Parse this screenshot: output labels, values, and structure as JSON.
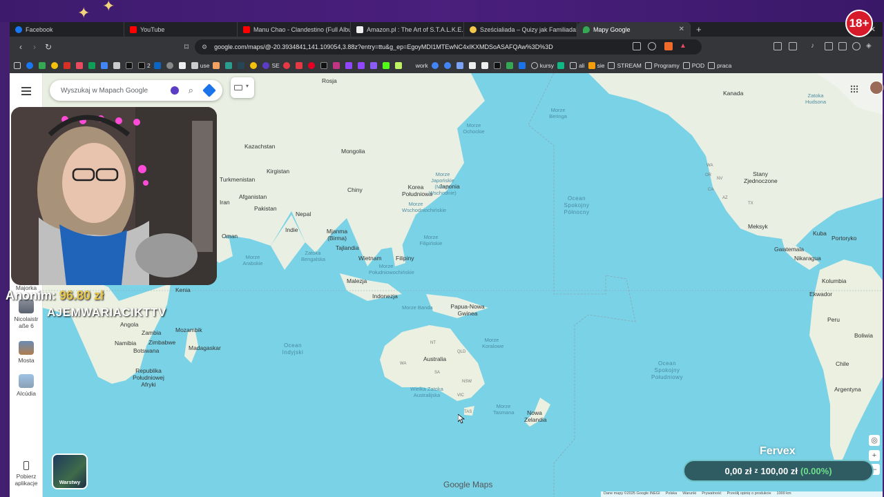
{
  "overlay": {
    "age_badge": "18+",
    "donor_label": "Anonim:",
    "donor_amount": "96.80 zł",
    "nickname": "AJEMWARIACIKTTV"
  },
  "tabs": [
    {
      "label": "Facebook",
      "color": "#1877f2"
    },
    {
      "label": "YouTube",
      "color": "#ff0000"
    },
    {
      "label": "Manu Chao - Clandestino (Full Album",
      "color": "#ff0000"
    },
    {
      "label": "Amazon.pl : The Art of S.T.A.L.K.E.R. 2",
      "color": "#f0f0f0"
    },
    {
      "label": "Sześcialiada – Quizy jak Familiada! Gr",
      "color": "#f2c94c"
    },
    {
      "label": "Mapy Google",
      "color": "#34a853"
    }
  ],
  "address": {
    "url": "google.com/maps/@-20.3934841,141.109054,3.88z?entry=ttu&g_ep=EgoyMDI1MTEwNC4xIKXMDSoASAFQAw%3D%3D"
  },
  "bookmarks": [
    "use",
    "SE",
    "work",
    "kursy",
    "ali",
    "sie",
    "STREAM",
    "Programy",
    "POD",
    "praca"
  ],
  "bookmark_counts": {
    "x2": "2"
  },
  "search": {
    "placeholder": "Wyszukaj w Mapach Google"
  },
  "rail": {
    "items": [
      {
        "label": "Majorka"
      },
      {
        "label": "Nicolaistr aße 6"
      },
      {
        "label": "Mosta"
      },
      {
        "label": "Alcúdia"
      }
    ],
    "get_app": "Pobierz aplikacje"
  },
  "map_labels": {
    "countries": [
      "Rosja",
      "Kazachstan",
      "Mongolia",
      "Kirgistan",
      "Turkmenistan",
      "Chiny",
      "Korea Południowa",
      "Japonia",
      "Afganistan",
      "Iran",
      "Pakistan",
      "Nepal",
      "Indie",
      "Mjanma (Birma)",
      "Tajlandia",
      "Oman",
      "Wietnam",
      "Filipiny",
      "Malezja",
      "Indonezja",
      "Papua-Nowa Gwinea",
      "Australia",
      "Nowa Zelandia",
      "Kenia",
      "Angola",
      "Mozambik",
      "Zambia",
      "Namibia",
      "Zimbabwe",
      "Botswana",
      "Madagaskar",
      "Republika Południowej Afryki",
      "Kanada",
      "Stany Zjednoczone",
      "Meksyk",
      "Kuba",
      "Portoryko",
      "Gwatemala",
      "Nikaragua",
      "Kolumbia",
      "Ekwador",
      "Peru",
      "Boliwia",
      "Chile",
      "Argentyna"
    ],
    "australia_states": [
      "NT",
      "QLD",
      "WA",
      "SA",
      "NSW",
      "VIC",
      "TAS"
    ],
    "us_states": [
      "WA",
      "OR",
      "NV",
      "CA",
      "AZ",
      "TX"
    ],
    "seas": [
      "Ocean Indyjski",
      "Ocean Spokojny Północny",
      "Ocean Spokojny Południowy",
      "Morze Beringa",
      "Morze Ochockie",
      "Morze Japońskie (Morze Wschodnie)",
      "Morze Wschodniochińskie",
      "Morze Południowochińskie",
      "Morze Filipińskie",
      "Zatoka Bengalska",
      "Morze Arabskie",
      "Morze Banda",
      "Morze Koralowe",
      "Wielka Zatoka Australijska",
      "Morze Tasmana",
      "Zatoka Hudsona"
    ]
  },
  "layers": {
    "label": "Warstwy"
  },
  "branding": {
    "maps_logo": "Google Maps"
  },
  "footer": [
    "Dane mapy ©2025 Google INEGI",
    "Polska",
    "Warunki",
    "Prywatność",
    "Prześlij opinię o produkcie",
    "1000 km"
  ],
  "donation_goal": {
    "title": "Fervex",
    "current": "0,00 zł",
    "separator": "z",
    "target": "100,00 zł",
    "percent": "(0.00%)"
  },
  "colors": {
    "ocean": "#79d2e6",
    "land": "#e8eee0",
    "frame": "#3d1b6c"
  }
}
